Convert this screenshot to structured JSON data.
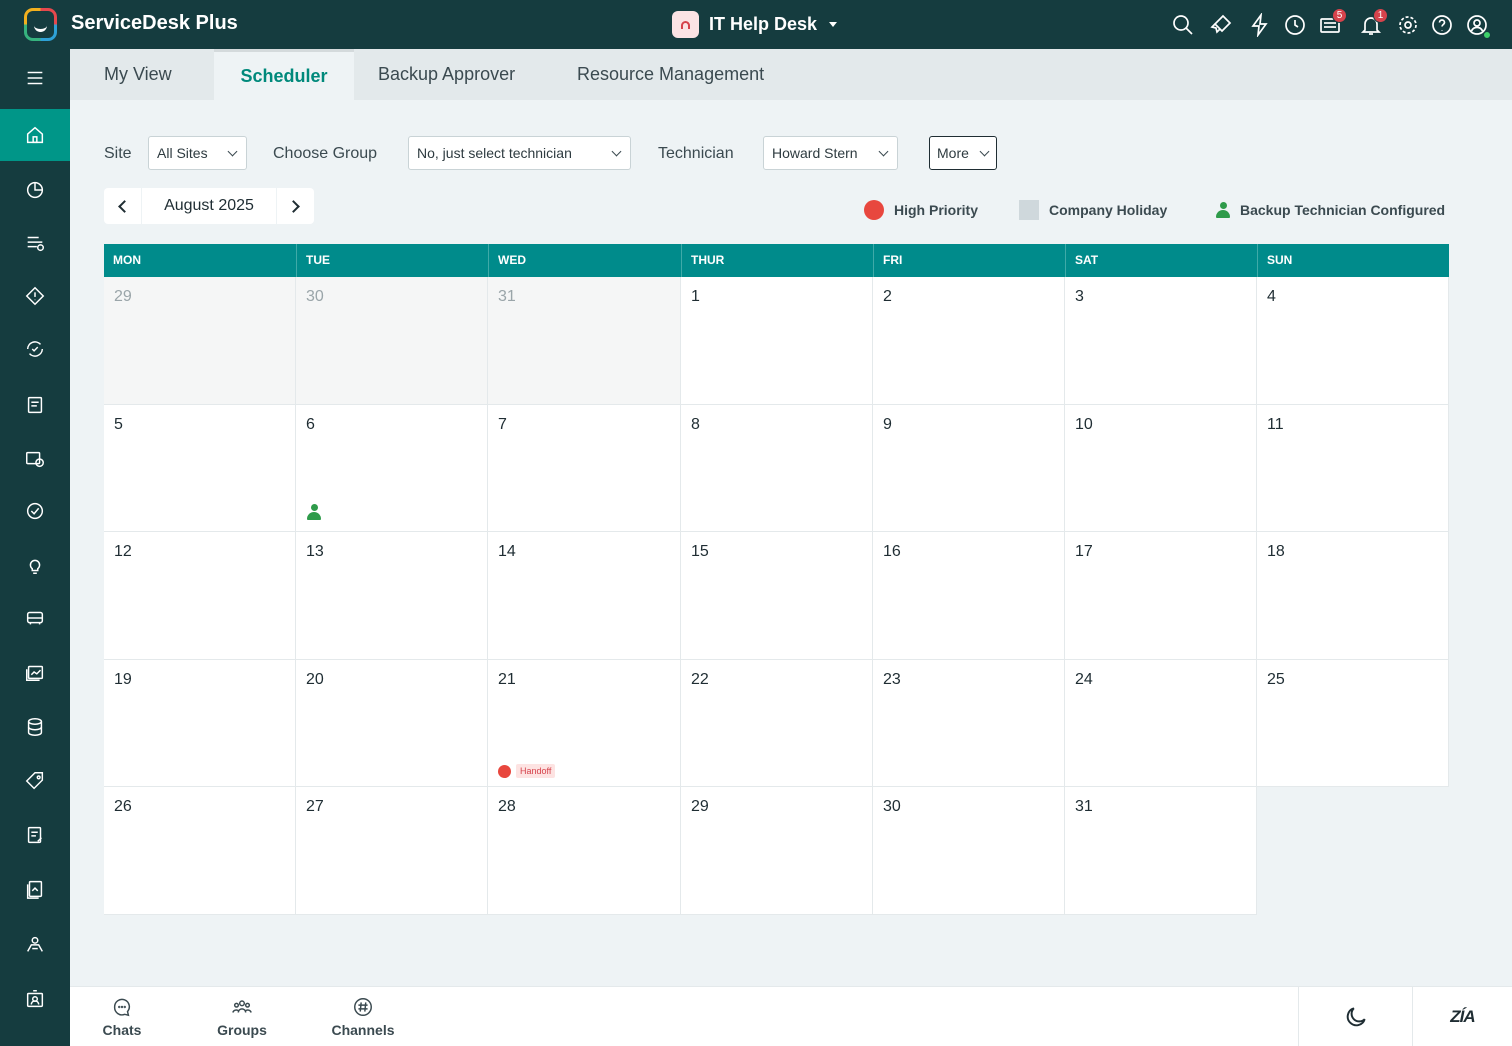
{
  "app": {
    "title": "ServiceDesk Plus"
  },
  "desk": {
    "name": "IT Help Desk"
  },
  "top_icons": [
    {
      "name": "search-icon"
    },
    {
      "name": "rocket-icon"
    },
    {
      "name": "lightning-icon"
    },
    {
      "name": "history-icon"
    },
    {
      "name": "announcements-icon",
      "badge": "5"
    },
    {
      "name": "bell-icon",
      "badge": "1"
    },
    {
      "name": "gear-icon"
    },
    {
      "name": "help-icon"
    },
    {
      "name": "user-profile-icon"
    }
  ],
  "tabs": [
    "My View",
    "Scheduler",
    "Backup Approver",
    "Resource Management"
  ],
  "active_tab": "Scheduler",
  "filters": {
    "site_label": "Site",
    "site_value": "All Sites",
    "group_label": "Choose Group",
    "group_value": "No, just select technician",
    "technician_label": "Technician",
    "technician_value": "Howard Stern",
    "more_label": "More"
  },
  "calendar": {
    "month": "August 2025",
    "weekdays": [
      "MON",
      "TUE",
      "WED",
      "THUR",
      "FRI",
      "SAT",
      "SUN"
    ],
    "weeks": [
      [
        "29",
        "30",
        "31",
        "1",
        "2",
        "3",
        "4"
      ],
      [
        "5",
        "6",
        "7",
        "8",
        "9",
        "10",
        "11"
      ],
      [
        "12",
        "13",
        "14",
        "15",
        "16",
        "17",
        "18"
      ],
      [
        "19",
        "20",
        "21",
        "22",
        "23",
        "24",
        "25"
      ],
      [
        "26",
        "27",
        "28",
        "29",
        "30",
        "31",
        ""
      ]
    ],
    "backup_technician_day": "6",
    "events": [
      {
        "day": "21",
        "label": "Handoff",
        "priority": "high"
      }
    ]
  },
  "legend": {
    "high_priority": "High Priority",
    "company_holiday": "Company Holiday",
    "backup_configured": "Backup Technician Configured"
  },
  "bottom": {
    "chats": "Chats",
    "groups": "Groups",
    "channels": "Channels",
    "zia": "ZÍA"
  },
  "colors": {
    "brand_dark": "#153c3f",
    "accent": "#009688",
    "header": "#008b8b",
    "priority": "#e8473e",
    "backup": "#2e9b4a"
  }
}
